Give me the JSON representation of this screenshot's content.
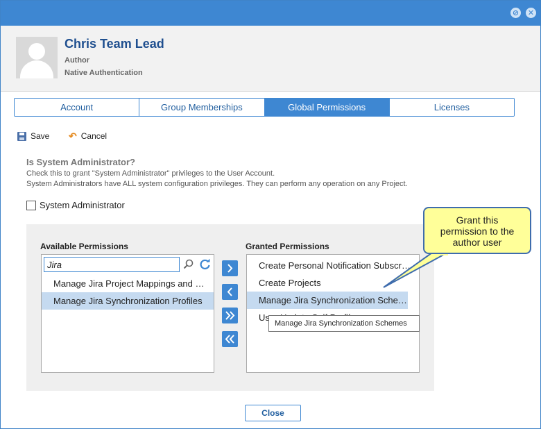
{
  "user": {
    "name": "Chris Team Lead",
    "role": "Author",
    "auth": "Native Authentication"
  },
  "tabs": [
    {
      "label": "Account"
    },
    {
      "label": "Group Memberships"
    },
    {
      "label": "Global Permissions"
    },
    {
      "label": "Licenses"
    }
  ],
  "active_tab": "Global Permissions",
  "toolbar": {
    "save_label": "Save",
    "cancel_label": "Cancel"
  },
  "sysadmin": {
    "title": "Is System Administrator?",
    "desc_line1": "Check this to grant \"System Administrator\" privileges to the User Account.",
    "desc_line2": "System Administrators have ALL system configuration privileges. They can perform any operation on any Project.",
    "checkbox_label": "System Administrator",
    "checked": false
  },
  "available": {
    "label": "Available Permissions",
    "search_value": "Jira",
    "items": [
      {
        "label": "Manage Jira Project Mappings and Sync Profiles",
        "selected": false
      },
      {
        "label": "Manage Jira Synchronization Profiles",
        "selected": true
      }
    ]
  },
  "granted": {
    "label": "Granted Permissions",
    "items": [
      {
        "label": "Create Personal Notification Subscriptions",
        "selected": false
      },
      {
        "label": "Create Projects",
        "selected": false
      },
      {
        "label": "Manage Jira Synchronization Schemes",
        "selected": true
      },
      {
        "label": "User Update Self Profile",
        "selected": false
      }
    ]
  },
  "tooltip": "Manage Jira Synchronization Schemes",
  "callout": {
    "line1": "Grant this",
    "line2": "permission to the",
    "line3": "author user"
  },
  "close_label": "Close",
  "colors": {
    "accent": "#3e87d2",
    "selection": "#c5daf0",
    "callout_bg": "#ffff99"
  }
}
